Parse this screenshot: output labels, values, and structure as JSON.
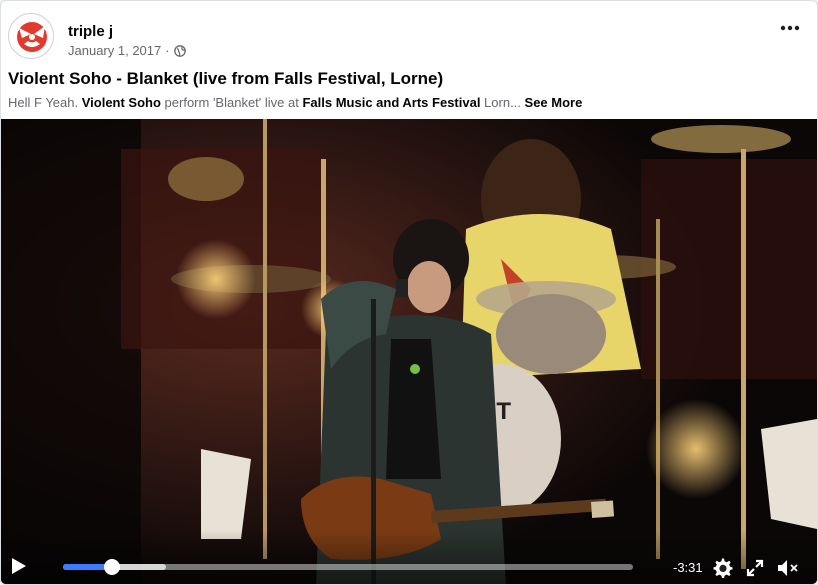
{
  "post": {
    "page_name": "triple j",
    "date": "January 1, 2017",
    "separator": "·",
    "audience_icon": "globe-icon",
    "more_icon": "more-options-icon",
    "title": "Violent Soho - Blanket (live from Falls Festival, Lorne)",
    "description": {
      "part1": "Hell F Yeah. ",
      "band": "Violent Soho",
      "part2": " perform 'Blanket' live at ",
      "festival": "Falls Music and Arts Festival",
      "part3": " Lorn...",
      "see_more": " See More"
    }
  },
  "video": {
    "progress": {
      "played": 0.086,
      "buffered": 0.18
    },
    "time_remaining": "-3:31",
    "icons": [
      "play-icon",
      "settings-icon",
      "fullscreen-icon",
      "mute-icon"
    ],
    "accent": "#3b7cff"
  },
  "colors": {
    "brand": "#e23b2d",
    "text": "#050505",
    "muted": "#65676b"
  }
}
